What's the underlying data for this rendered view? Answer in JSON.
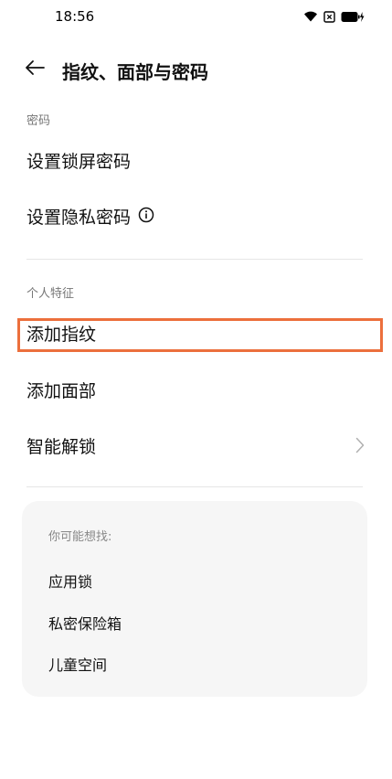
{
  "status_bar": {
    "time": "18:56"
  },
  "header": {
    "title": "指纹、面部与密码"
  },
  "sections": {
    "password": {
      "label": "密码",
      "items": [
        "设置锁屏密码",
        "设置隐私密码"
      ]
    },
    "features": {
      "label": "个人特征",
      "items": [
        "添加指纹",
        "添加面部",
        "智能解锁"
      ]
    }
  },
  "suggestions": {
    "heading": "你可能想找:",
    "items": [
      "应用锁",
      "私密保险箱",
      "儿童空间"
    ]
  },
  "colors": {
    "highlight": "#ec6f3c",
    "card_bg": "#f6f6f6"
  },
  "icons": [
    "back-arrow-icon",
    "info-icon",
    "chevron-right-icon",
    "wifi-icon",
    "sim-icon",
    "battery-icon"
  ]
}
